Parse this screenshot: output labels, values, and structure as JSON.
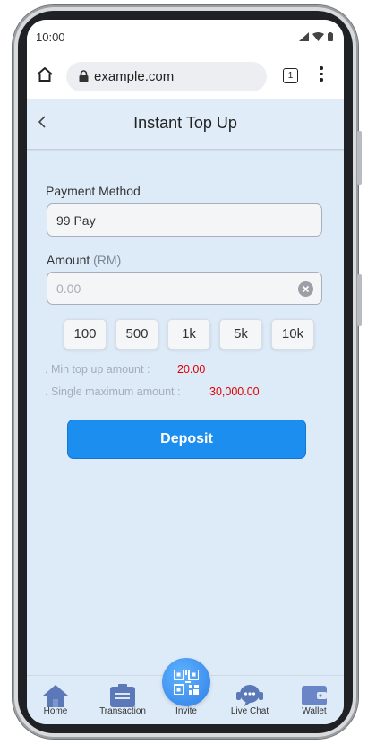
{
  "status_bar": {
    "time": "10:00"
  },
  "browser": {
    "url": "example.com",
    "tab_count": "1"
  },
  "header": {
    "title": "Instant Top Up"
  },
  "payment": {
    "label": "Payment Method",
    "value": "99 Pay"
  },
  "amount": {
    "label": "Amount",
    "unit": "(RM)",
    "placeholder": "0.00"
  },
  "quick_amounts": [
    "100",
    "500",
    "1k",
    "5k",
    "10k"
  ],
  "limits": {
    "min_label": ". Min top up amount :",
    "min_value": "20.00",
    "max_label": ". Single maximum amount :",
    "max_value": "30,000.00"
  },
  "deposit_button": "Deposit",
  "bottom_nav": {
    "home": "Home",
    "transaction": "Transaction",
    "invite": "Invite",
    "live_chat": "Live Chat",
    "wallet": "Wallet"
  },
  "colors": {
    "accent": "#1c8ef0",
    "app_background": "#ddeaf8",
    "limit_value": "#e00000",
    "nav_icon": "#5b78b8"
  }
}
